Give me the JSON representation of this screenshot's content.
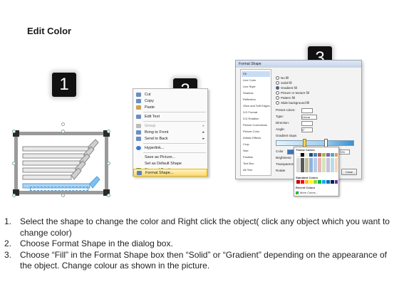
{
  "title": "Edit Color",
  "steps": [
    "1",
    "2",
    "3"
  ],
  "context_menu": {
    "items": [
      {
        "label": "Cut",
        "icon": "scissors-icon",
        "submenu": false
      },
      {
        "label": "Copy",
        "icon": "copy-icon",
        "submenu": false
      },
      {
        "label": "Paste",
        "icon": "paste-icon",
        "submenu": false
      },
      {
        "label": "Edit Text",
        "icon": "edit-text-icon",
        "submenu": false
      },
      {
        "label": "Group",
        "icon": "group-icon",
        "submenu": true
      },
      {
        "label": "Bring to Front",
        "icon": "bring-front-icon",
        "submenu": true
      },
      {
        "label": "Send to Back",
        "icon": "send-back-icon",
        "submenu": true
      },
      {
        "label": "Hyperlink...",
        "icon": "hyperlink-icon",
        "submenu": false
      },
      {
        "label": "Save as Picture...",
        "icon": "",
        "submenu": false
      },
      {
        "label": "Set as Default Shape",
        "icon": "",
        "submenu": false
      },
      {
        "label": "Size and Position...",
        "icon": "size-icon",
        "submenu": false
      },
      {
        "label": "Format Shape...",
        "icon": "format-shape-icon",
        "submenu": false
      }
    ],
    "highlighted": "Format Shape..."
  },
  "format_dialog": {
    "title": "Format Shape",
    "sidebar": [
      "Fill",
      "Line Color",
      "Line Style",
      "Shadow",
      "Reflection",
      "Glow and Soft Edges",
      "3-D Format",
      "3-D Rotation",
      "Picture Corrections",
      "Picture Color",
      "Artistic Effects",
      "Crop",
      "Size",
      "Position",
      "Text Box",
      "Alt Text"
    ],
    "selected_sidebar": "Fill",
    "fill_options": [
      "No fill",
      "Solid fill",
      "Gradient fill",
      "Picture or texture fill",
      "Pattern fill",
      "Slide background fill"
    ],
    "selected_fill": "Gradient fill",
    "fields": {
      "preset_colors": "Preset colors:",
      "type_label": "Type:",
      "type_value": "Linear",
      "direction_label": "Direction:",
      "angle_label": "Angle:",
      "angle_value": "0°",
      "gradient_stops": "Gradient stops",
      "color_label": "Color",
      "position_label": "Position:",
      "position_value": "70%",
      "brightness_label": "Brightness:",
      "transparency_label": "Transparency:",
      "rotate_label": "Rotate"
    },
    "palette": {
      "theme_colors": "Theme Colors",
      "standard_colors": "Standard Colors",
      "recent_colors": "Recent Colors",
      "more_colors": "More Colors..."
    },
    "close_button": "Close"
  },
  "instructions": [
    {
      "num": "1.",
      "text": "Select the shape to change the color and Right click the object( click any object which you want to change color)"
    },
    {
      "num": "2.",
      "text": "Choose Format Shape in the dialog box."
    },
    {
      "num": "3.",
      "text": "Choose “Fill” in the Format Shape box then “Solid” or “Gradient” depending on the appearance of the object. Change colour as shown in the picture."
    }
  ]
}
